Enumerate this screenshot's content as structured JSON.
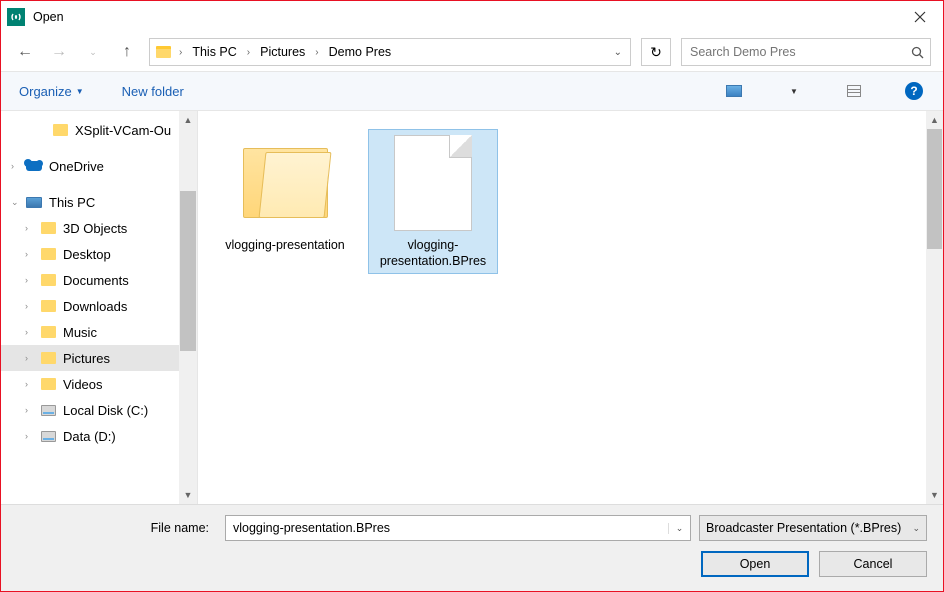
{
  "title": "Open",
  "breadcrumb": {
    "items": [
      "This PC",
      "Pictures",
      "Demo Pres"
    ]
  },
  "search": {
    "placeholder": "Search Demo Pres"
  },
  "toolbar": {
    "organize": "Organize",
    "new_folder": "New folder"
  },
  "tree": {
    "items": [
      {
        "label": "XSplit-VCam-Ou",
        "icon": "folder",
        "indent": 2
      },
      {
        "label": "",
        "icon": "none",
        "indent": 0
      },
      {
        "label": "OneDrive",
        "icon": "onedrive",
        "indent": 0,
        "exp": "›"
      },
      {
        "label": "",
        "icon": "none",
        "indent": 0
      },
      {
        "label": "This PC",
        "icon": "thispc",
        "indent": 0,
        "exp": "⌄"
      },
      {
        "label": "3D Objects",
        "icon": "folder",
        "indent": 1,
        "exp": "›"
      },
      {
        "label": "Desktop",
        "icon": "folder",
        "indent": 1,
        "exp": "›"
      },
      {
        "label": "Documents",
        "icon": "folder",
        "indent": 1,
        "exp": "›"
      },
      {
        "label": "Downloads",
        "icon": "folder",
        "indent": 1,
        "exp": "›"
      },
      {
        "label": "Music",
        "icon": "folder",
        "indent": 1,
        "exp": "›"
      },
      {
        "label": "Pictures",
        "icon": "folder",
        "indent": 1,
        "exp": "›",
        "selected": true
      },
      {
        "label": "Videos",
        "icon": "folder",
        "indent": 1,
        "exp": "›"
      },
      {
        "label": "Local Disk (C:)",
        "icon": "disk",
        "indent": 1,
        "exp": "›"
      },
      {
        "label": "Data (D:)",
        "icon": "disk",
        "indent": 1,
        "exp": "›"
      }
    ]
  },
  "items": [
    {
      "label": "vlogging-presentation",
      "kind": "folder"
    },
    {
      "label": "vlogging-presentation.BPres",
      "kind": "file",
      "selected": true
    }
  ],
  "filename": {
    "label": "File name:",
    "value": "vlogging-presentation.BPres"
  },
  "filter": {
    "text": "Broadcaster Presentation (*.BPres)"
  },
  "buttons": {
    "open": "Open",
    "cancel": "Cancel"
  }
}
